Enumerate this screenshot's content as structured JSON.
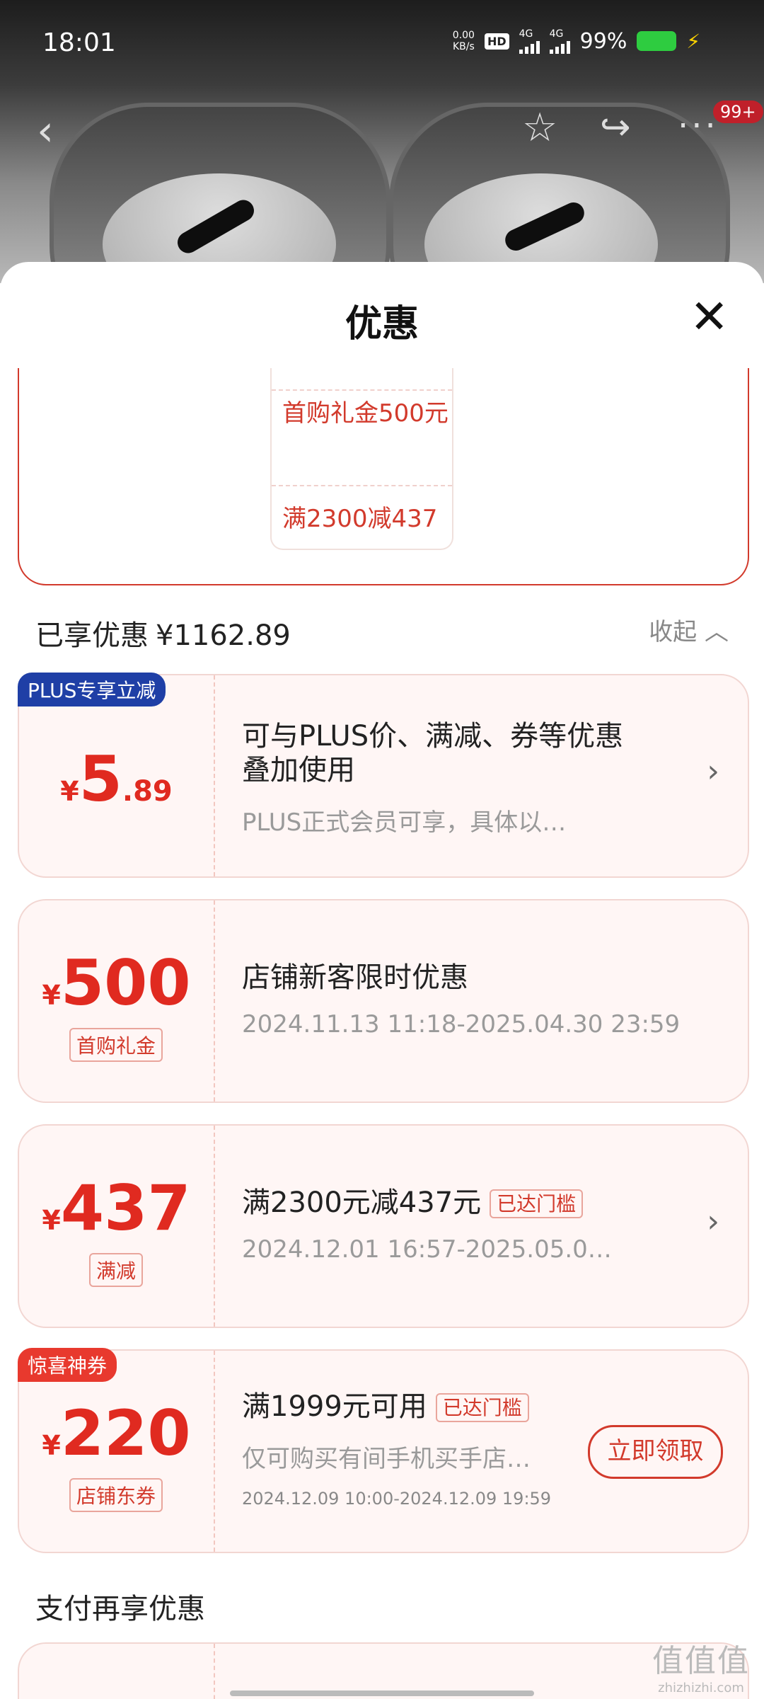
{
  "status_bar": {
    "time": "18:01",
    "net_speed": "0.00",
    "net_unit": "KB/s",
    "hd": "HD",
    "sim1": "4G",
    "sim2": "4G",
    "battery": "99%"
  },
  "nav": {
    "back_icon": "chevron-left-icon",
    "favorite_icon": "star-icon",
    "share_icon": "share-icon",
    "more_icon": "more-icon",
    "more_badge": "99+"
  },
  "sheet": {
    "title": "优惠",
    "close_icon": "close-icon"
  },
  "summary_card": {
    "line1": "首购礼金500元",
    "line2": "满2300减437"
  },
  "enjoyed": {
    "label": "已享优惠",
    "amount": "¥1162.89",
    "collapse_label": "收起"
  },
  "coupons": [
    {
      "ribbon": "PLUS专享立减",
      "currency": "¥",
      "amount_int": "5",
      "amount_dec": ".89",
      "title": "可与PLUS价、满减、券等优惠叠加使用",
      "subtitle": "PLUS正式会员可享，具体以…"
    },
    {
      "currency": "¥",
      "amount_int": "500",
      "tag": "首购礼金",
      "title": "店铺新客限时优惠",
      "subtitle": "2024.11.13 11:18-2025.04.30 23:59"
    },
    {
      "currency": "¥",
      "amount_int": "437",
      "tag": "满减",
      "title": "满2300元减437元",
      "status": "已达门槛",
      "subtitle": "2024.12.01 16:57-2025.05.0…"
    },
    {
      "ribbon": "惊喜神券",
      "currency": "¥",
      "amount_int": "220",
      "tag": "店铺东券",
      "title": "满1999元可用",
      "status": "已达门槛",
      "subtitle": "仅可购买有间手机买手店…",
      "date": "2024.12.09 10:00-2024.12.09 19:59",
      "action": "立即领取"
    }
  ],
  "payment": {
    "title": "支付再享优惠"
  },
  "watermark": {
    "big": "值值值",
    "small": "zhizhizhi.com"
  }
}
